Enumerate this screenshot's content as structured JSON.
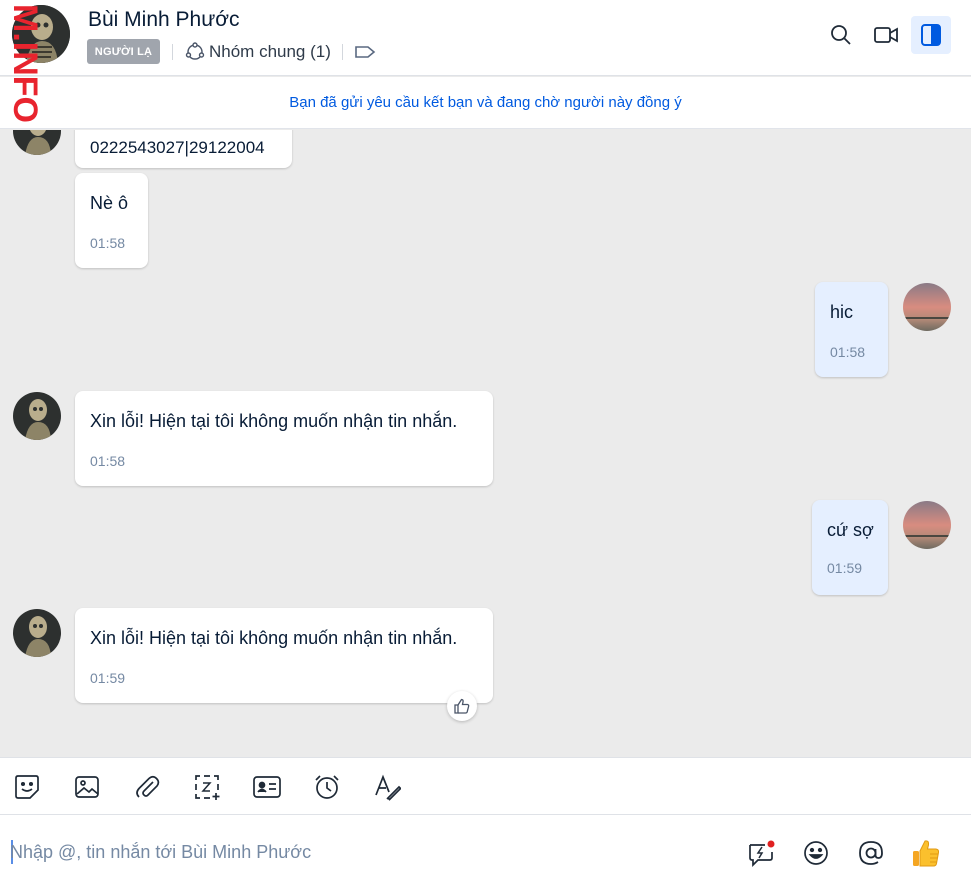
{
  "header": {
    "contact_name": "Bùi Minh Phước",
    "stranger_badge": "NGƯỜI LẠ",
    "common_group": "Nhóm chung (1)"
  },
  "banner": {
    "text": "Bạn đã gửi yêu cầu kết bạn và đang chờ người này đồng ý"
  },
  "watermark": "M.INFO",
  "messages": [
    {
      "from": "them",
      "text": "0222543027|29122004",
      "time": ""
    },
    {
      "from": "them",
      "text": "Nè ô",
      "time": "01:58"
    },
    {
      "from": "me",
      "text": "hic",
      "time": "01:58"
    },
    {
      "from": "them",
      "text": "Xin lỗi! Hiện tại tôi không muốn nhận tin nhắn.",
      "time": "01:58"
    },
    {
      "from": "me",
      "text": "cứ sợ",
      "time": "01:59"
    },
    {
      "from": "them",
      "text": "Xin lỗi! Hiện tại tôi không muốn nhận tin nhắn.",
      "time": "01:59"
    }
  ],
  "composer": {
    "placeholder": "Nhập @, tin nhắn tới Bùi Minh Phước"
  },
  "colors": {
    "accent": "#005ae0",
    "my_bubble": "#e5efff",
    "badge": "#a0a5ad",
    "notify_dot": "#e02020"
  }
}
